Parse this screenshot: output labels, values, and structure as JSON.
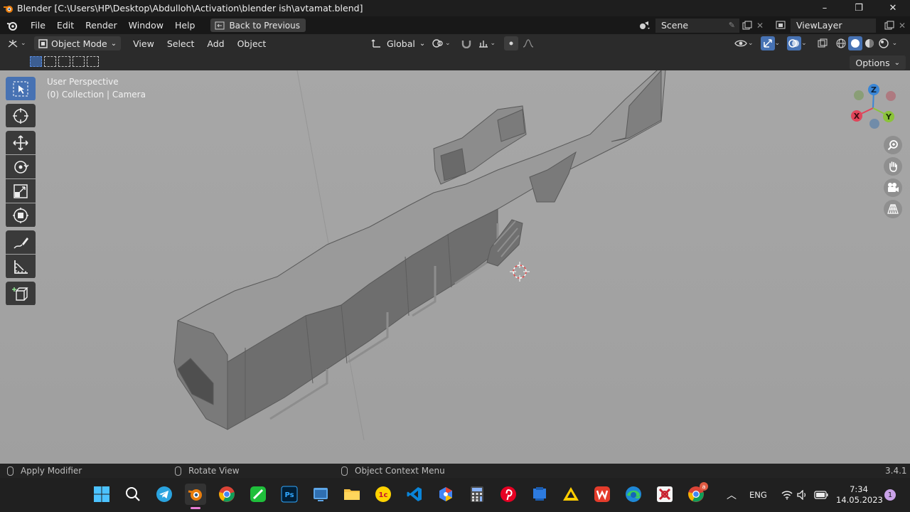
{
  "window": {
    "title": "Blender [C:\\Users\\HP\\Desktop\\Abdulloh\\Activation\\blender ish\\avtamat.blend]",
    "controls": [
      "–",
      "❐",
      "✕"
    ]
  },
  "topbar": {
    "menus": [
      "File",
      "Edit",
      "Render",
      "Window",
      "Help"
    ],
    "back_button": "Back to Previous",
    "scene": "Scene",
    "view_layer": "ViewLayer"
  },
  "viewport_header": {
    "mode": "Object Mode",
    "menus": [
      "View",
      "Select",
      "Add",
      "Object"
    ],
    "transform_orientation": "Global"
  },
  "viewport": {
    "perspective": "User Perspective",
    "collection": "(0) Collection | Camera",
    "options": "Options",
    "background": "#a3a3a3",
    "gizmo_axes": [
      "Z",
      "X",
      "Y"
    ]
  },
  "statusbar": {
    "left": "Apply Modifier",
    "middle": "Rotate View",
    "right": "Object Context Menu",
    "version": "3.4.1"
  },
  "taskbar": {
    "language": "ENG",
    "time": "7:34",
    "date": "14.05.2023",
    "notifications": "1",
    "chrome_badge": "a"
  },
  "colors": {
    "accent": "#4772b3",
    "axis_x": "#e0455a",
    "axis_y": "#8bc33a",
    "axis_z": "#3a86d6"
  }
}
